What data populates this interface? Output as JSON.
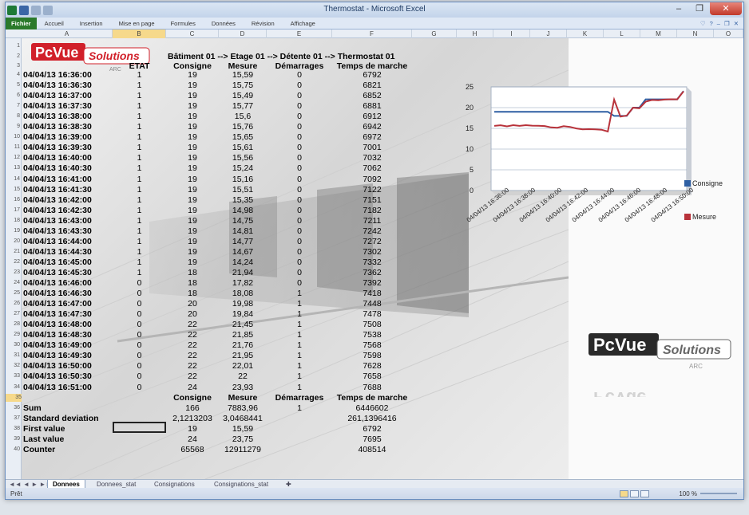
{
  "window": {
    "title": "Thermostat - Microsoft Excel"
  },
  "ribbon": {
    "file": "Fichier",
    "tabs": [
      "Accueil",
      "Insertion",
      "Mise en page",
      "Formules",
      "Données",
      "Révision",
      "Affichage"
    ]
  },
  "columns": [
    "A",
    "B",
    "C",
    "D",
    "E",
    "F",
    "G",
    "H",
    "I",
    "J",
    "K",
    "L",
    "M",
    "N",
    "O"
  ],
  "rows": [
    "1",
    "2",
    "3",
    "4",
    "5",
    "6",
    "7",
    "8",
    "9",
    "10",
    "11",
    "12",
    "13",
    "14",
    "15",
    "16",
    "17",
    "18",
    "19",
    "20",
    "21",
    "22",
    "23",
    "24",
    "25",
    "26",
    "27",
    "28",
    "29",
    "30",
    "31",
    "32",
    "33",
    "34",
    "35",
    "36",
    "37",
    "38",
    "39",
    "40"
  ],
  "logo": {
    "brand": "PcVue",
    "suffix": "Solutions",
    "tag": "ARC"
  },
  "sheet": {
    "title": "Bâtiment 01 --> Etage 01 --> Détente 01 --> Thermostat 01",
    "headers": {
      "etat": "ETAT",
      "consigne": "Consigne",
      "mesure": "Mesure",
      "demarrages": "Démarrages",
      "temps": "Temps de marche"
    },
    "data": [
      [
        "04/04/13 16:36:00",
        "1",
        "19",
        "15,59",
        "0",
        "6792"
      ],
      [
        "04/04/13 16:36:30",
        "1",
        "19",
        "15,75",
        "0",
        "6821"
      ],
      [
        "04/04/13 16:37:00",
        "1",
        "19",
        "15,49",
        "0",
        "6852"
      ],
      [
        "04/04/13 16:37:30",
        "1",
        "19",
        "15,77",
        "0",
        "6881"
      ],
      [
        "04/04/13 16:38:00",
        "1",
        "19",
        "15,6",
        "0",
        "6912"
      ],
      [
        "04/04/13 16:38:30",
        "1",
        "19",
        "15,76",
        "0",
        "6942"
      ],
      [
        "04/04/13 16:39:00",
        "1",
        "19",
        "15,65",
        "0",
        "6972"
      ],
      [
        "04/04/13 16:39:30",
        "1",
        "19",
        "15,61",
        "0",
        "7001"
      ],
      [
        "04/04/13 16:40:00",
        "1",
        "19",
        "15,56",
        "0",
        "7032"
      ],
      [
        "04/04/13 16:40:30",
        "1",
        "19",
        "15,24",
        "0",
        "7062"
      ],
      [
        "04/04/13 16:41:00",
        "1",
        "19",
        "15,16",
        "0",
        "7092"
      ],
      [
        "04/04/13 16:41:30",
        "1",
        "19",
        "15,51",
        "0",
        "7122"
      ],
      [
        "04/04/13 16:42:00",
        "1",
        "19",
        "15,35",
        "0",
        "7151"
      ],
      [
        "04/04/13 16:42:30",
        "1",
        "19",
        "14,98",
        "0",
        "7182"
      ],
      [
        "04/04/13 16:43:00",
        "1",
        "19",
        "14,75",
        "0",
        "7211"
      ],
      [
        "04/04/13 16:43:30",
        "1",
        "19",
        "14,81",
        "0",
        "7242"
      ],
      [
        "04/04/13 16:44:00",
        "1",
        "19",
        "14,77",
        "0",
        "7272"
      ],
      [
        "04/04/13 16:44:30",
        "1",
        "19",
        "14,67",
        "0",
        "7302"
      ],
      [
        "04/04/13 16:45:00",
        "1",
        "19",
        "14,24",
        "0",
        "7332"
      ],
      [
        "04/04/13 16:45:30",
        "1",
        "18",
        "21,94",
        "0",
        "7362"
      ],
      [
        "04/04/13 16:46:00",
        "0",
        "18",
        "17,82",
        "0",
        "7392"
      ],
      [
        "04/04/13 16:46:30",
        "0",
        "18",
        "18,08",
        "1",
        "7418"
      ],
      [
        "04/04/13 16:47:00",
        "0",
        "20",
        "19,98",
        "1",
        "7448"
      ],
      [
        "04/04/13 16:47:30",
        "0",
        "20",
        "19,84",
        "1",
        "7478"
      ],
      [
        "04/04/13 16:48:00",
        "0",
        "22",
        "21,45",
        "1",
        "7508"
      ],
      [
        "04/04/13 16:48:30",
        "0",
        "22",
        "21,85",
        "1",
        "7538"
      ],
      [
        "04/04/13 16:49:00",
        "0",
        "22",
        "21,76",
        "1",
        "7568"
      ],
      [
        "04/04/13 16:49:30",
        "0",
        "22",
        "21,95",
        "1",
        "7598"
      ],
      [
        "04/04/13 16:50:00",
        "0",
        "22",
        "22,01",
        "1",
        "7628"
      ],
      [
        "04/04/13 16:50:30",
        "0",
        "22",
        "22",
        "1",
        "7658"
      ],
      [
        "04/04/13 16:51:00",
        "0",
        "24",
        "23,93",
        "1",
        "7688"
      ]
    ],
    "stats_headers": {
      "consigne": "Consigne",
      "mesure": "Mesure",
      "demarrages": "Démarrages",
      "temps": "Temps de marche"
    },
    "stats": [
      {
        "label": "Sum",
        "consigne": "166",
        "mesure": "7883,96",
        "demarrages": "1",
        "temps": "6446602"
      },
      {
        "label": "Standard deviation",
        "consigne": "2,1213203",
        "mesure": "3,0468441",
        "demarrages": "",
        "temps": "261,1396416"
      },
      {
        "label": "First value",
        "consigne": "19",
        "mesure": "15,59",
        "demarrages": "",
        "temps": "6792"
      },
      {
        "label": "Last value",
        "consigne": "24",
        "mesure": "23,75",
        "demarrages": "",
        "temps": "7695"
      },
      {
        "label": "Counter",
        "consigne": "65568",
        "mesure": "12911279",
        "demarrages": "",
        "temps": "408514"
      }
    ]
  },
  "chart_data": {
    "type": "line",
    "title": "",
    "xlabel": "",
    "ylabel": "",
    "ylim": [
      0,
      25
    ],
    "yticks": [
      "0",
      "5",
      "10",
      "15",
      "20",
      "25"
    ],
    "x": [
      "04/04/13 16:36:00",
      "04/04/13 16:38:00",
      "04/04/13 16:40:00",
      "04/04/13 16:42:00",
      "04/04/13 16:44:00",
      "04/04/13 16:46:00",
      "04/04/13 16:48:00",
      "04/04/13 16:50:00"
    ],
    "series": [
      {
        "name": "Consigne",
        "color": "#2e5fa3",
        "values": [
          19,
          19,
          19,
          19,
          19,
          19,
          19,
          19,
          19,
          19,
          19,
          19,
          19,
          19,
          19,
          19,
          19,
          19,
          19,
          18,
          18,
          18,
          20,
          20,
          22,
          22,
          22,
          22,
          22,
          22,
          24
        ]
      },
      {
        "name": "Mesure",
        "color": "#b8323a",
        "values": [
          15.59,
          15.75,
          15.49,
          15.77,
          15.6,
          15.76,
          15.65,
          15.61,
          15.56,
          15.24,
          15.16,
          15.51,
          15.35,
          14.98,
          14.75,
          14.81,
          14.77,
          14.67,
          14.24,
          21.94,
          17.82,
          18.08,
          19.98,
          19.84,
          21.45,
          21.85,
          21.76,
          21.95,
          22.01,
          22,
          23.93
        ]
      }
    ],
    "legend": "right",
    "grid": true
  },
  "sheet_tabs": [
    "Donnees",
    "Donnees_stat",
    "Consignations",
    "Consignations_stat"
  ],
  "status": {
    "ready": "Prêt",
    "zoom": "100 %"
  }
}
